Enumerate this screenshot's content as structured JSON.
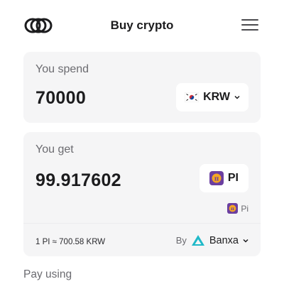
{
  "header": {
    "title": "Buy crypto",
    "logo_icon": "linked-rings-logo",
    "menu_icon": "hamburger-menu-icon"
  },
  "spend": {
    "label": "You spend",
    "amount": "70000",
    "currency": {
      "code": "KRW",
      "flag_icon": "south-korea-flag-icon"
    }
  },
  "get": {
    "label": "You get",
    "amount": "99.917602",
    "currency": {
      "code": "PI",
      "icon": "pi-coin-icon"
    },
    "network": {
      "label": "Pi",
      "icon": "pi-coin-icon"
    },
    "rate": "1 PI ≈ 700.58 KRW",
    "provider": {
      "prefix": "By",
      "name": "Banxa",
      "logo_icon": "banxa-triangle-logo"
    }
  },
  "pay_using": {
    "label": "Pay using"
  },
  "colors": {
    "card_bg": "#f5f5f6",
    "pi_purple": "#6b3fa0",
    "banxa_teal": "#1fb9c8",
    "text_muted": "#6b6b70"
  }
}
